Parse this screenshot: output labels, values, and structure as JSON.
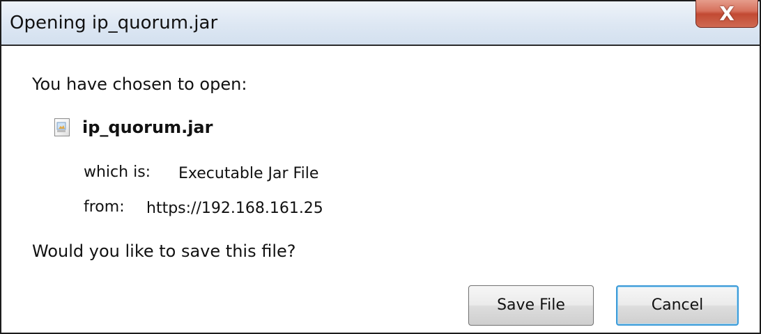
{
  "window": {
    "title": "Opening ip_quorum.jar",
    "close_glyph": "X"
  },
  "dialog": {
    "prompt": "You have chosen to open:",
    "file": {
      "icon": "file-icon",
      "name": "ip_quorum.jar"
    },
    "details": {
      "type_label": "which is:",
      "type_value": "Executable Jar File",
      "from_label": "from:",
      "from_value": "https://192.168.161.25"
    },
    "question": "Would you like to save this file?",
    "buttons": {
      "save_label": "Save File",
      "cancel_label": "Cancel"
    }
  },
  "colors": {
    "titlebar": "#dde7f3",
    "close_button": "#c24a33",
    "default_button_border": "#3c9ad7"
  }
}
